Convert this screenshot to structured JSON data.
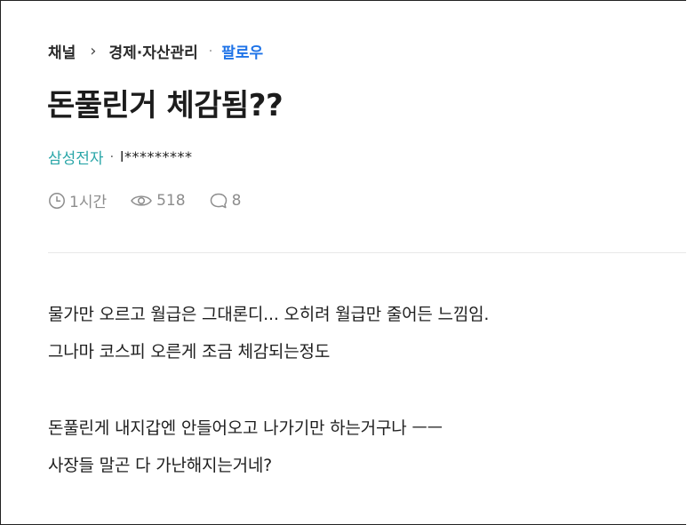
{
  "breadcrumb": {
    "channel": "채널",
    "chevron": "›",
    "category": "경제·자산관리",
    "dot": "·",
    "follow": "팔로우"
  },
  "post": {
    "title": "돈풀린거 체감됨??",
    "company": "삼성전자",
    "author_dot": "·",
    "nickname": "l*********",
    "meta": {
      "time": "1시간",
      "views": "518",
      "comments": "8"
    },
    "body": [
      "물가만 오르고 월급은 그대론디... 오히려 월급만 줄어든 느낌임.",
      "그나마 코스피 오른게 조금 체감되는정도",
      "",
      "돈풀린게 내지갑엔 안들어오고 나가기만 하는거구나 ㅡㅡ",
      "사장들 말곤 다 가난해지는거네?"
    ]
  },
  "icons": {
    "time": "clock-icon",
    "views": "eye-icon",
    "comments": "comment-bubble-icon"
  },
  "colors": {
    "follow": "#1e73e8",
    "company": "#2aa6a8",
    "meta": "#8d8d8d"
  }
}
